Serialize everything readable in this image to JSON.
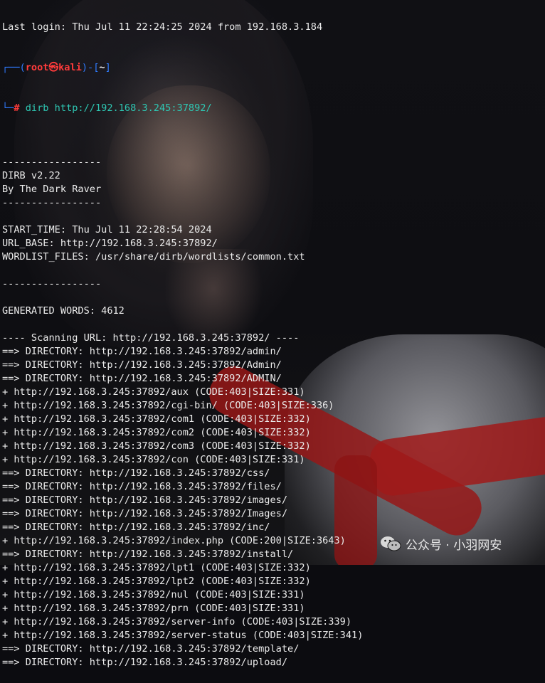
{
  "terminal": {
    "last_login": "Last login: Thu Jul 11 22:24:25 2024 from 192.168.3.184",
    "prompt_frame_top_left": "┌──(",
    "prompt_user": "root",
    "prompt_at": "㉿",
    "prompt_host": "kali",
    "prompt_frame_mid": ")-[",
    "prompt_cwd": "~",
    "prompt_frame_end": "]",
    "prompt_frame_bottom": "└─",
    "prompt_hash": "# ",
    "command": "dirb http://192.168.3.245:37892/",
    "lines": [
      "",
      "-----------------",
      "DIRB v2.22",
      "By The Dark Raver",
      "-----------------",
      "",
      "START_TIME: Thu Jul 11 22:28:54 2024",
      "URL_BASE: http://192.168.3.245:37892/",
      "WORDLIST_FILES: /usr/share/dirb/wordlists/common.txt",
      "",
      "-----------------",
      "",
      "GENERATED WORDS: 4612",
      "",
      "---- Scanning URL: http://192.168.3.245:37892/ ----",
      "==> DIRECTORY: http://192.168.3.245:37892/admin/",
      "==> DIRECTORY: http://192.168.3.245:37892/Admin/",
      "==> DIRECTORY: http://192.168.3.245:37892/ADMIN/",
      "+ http://192.168.3.245:37892/aux (CODE:403|SIZE:331)",
      "+ http://192.168.3.245:37892/cgi-bin/ (CODE:403|SIZE:336)",
      "+ http://192.168.3.245:37892/com1 (CODE:403|SIZE:332)",
      "+ http://192.168.3.245:37892/com2 (CODE:403|SIZE:332)",
      "+ http://192.168.3.245:37892/com3 (CODE:403|SIZE:332)",
      "+ http://192.168.3.245:37892/con (CODE:403|SIZE:331)",
      "==> DIRECTORY: http://192.168.3.245:37892/css/",
      "==> DIRECTORY: http://192.168.3.245:37892/files/",
      "==> DIRECTORY: http://192.168.3.245:37892/images/",
      "==> DIRECTORY: http://192.168.3.245:37892/Images/",
      "==> DIRECTORY: http://192.168.3.245:37892/inc/",
      "+ http://192.168.3.245:37892/index.php (CODE:200|SIZE:3643)",
      "==> DIRECTORY: http://192.168.3.245:37892/install/",
      "+ http://192.168.3.245:37892/lpt1 (CODE:403|SIZE:332)",
      "+ http://192.168.3.245:37892/lpt2 (CODE:403|SIZE:332)",
      "+ http://192.168.3.245:37892/nul (CODE:403|SIZE:331)",
      "+ http://192.168.3.245:37892/prn (CODE:403|SIZE:331)",
      "+ http://192.168.3.245:37892/server-info (CODE:403|SIZE:339)",
      "+ http://192.168.3.245:37892/server-status (CODE:403|SIZE:341)",
      "==> DIRECTORY: http://192.168.3.245:37892/template/",
      "==> DIRECTORY: http://192.168.3.245:37892/upload/"
    ]
  },
  "watermark": {
    "text": "公众号 · 小羽网安",
    "icon": "wechat-icon"
  },
  "colors": {
    "prompt_frame": "#2f7bff",
    "prompt_user_host": "#ff3b3b",
    "command": "#2ec7b3",
    "text": "#ebebeb"
  }
}
